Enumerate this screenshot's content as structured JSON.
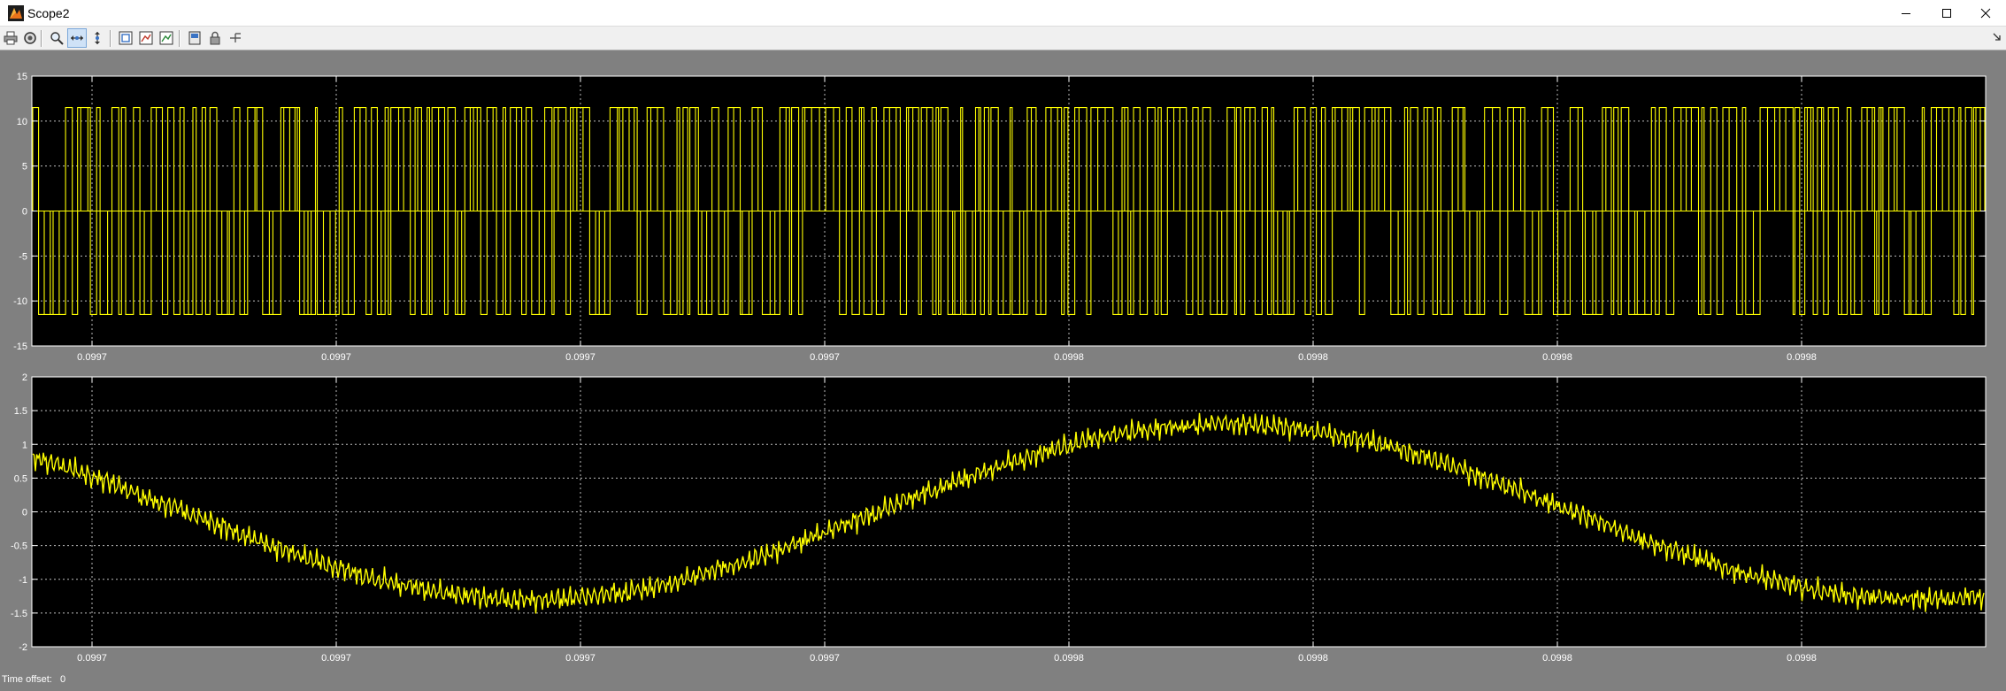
{
  "window": {
    "title": "Scope2",
    "icon": "simulink-scope-icon",
    "buttons": [
      "minimize-icon",
      "maximize-icon",
      "close-icon"
    ]
  },
  "toolbar": {
    "items": [
      "print-icon",
      "parameters-icon",
      "zoom-icon",
      "zoom-x-icon",
      "zoom-y-icon",
      "autoscale-icon",
      "save-axes-settings-icon",
      "restore-axes-settings-icon",
      "floating-scope-icon",
      "lock-axes-icon",
      "signal-selection-icon"
    ],
    "active": "zoom-x-icon"
  },
  "colors": {
    "plot_bg": "#000000",
    "signal": "#ffff00",
    "axes_frame": "#808080",
    "grid": "#bdbdbd",
    "text": "#ffffff"
  },
  "footer": {
    "time_offset_label": "Time offset:",
    "time_offset_value": "0"
  },
  "chart_data": [
    {
      "type": "line",
      "signal": "bipolar PWM pulse train switching between +11.5 and -11.5",
      "ylim": [
        -15,
        15
      ],
      "yticks": [
        "15",
        "10",
        "5",
        "0",
        "-5",
        "-10",
        "-15"
      ],
      "xticks": [
        "0.0997",
        "0.0997",
        "0.0997",
        "0.0997",
        "0.0998",
        "0.0998",
        "0.0998",
        "0.0998"
      ],
      "levels": [
        11.5,
        -11.5
      ],
      "grid": true
    },
    {
      "type": "line",
      "signal": "noisy sinusoid, approx. one cycle visible, amplitude ~1.3",
      "ylim": [
        -2,
        2
      ],
      "yticks": [
        "2",
        "1.5",
        "1",
        "0.5",
        "0",
        "-0.5",
        "-1",
        "-1.5",
        "-2"
      ],
      "xticks": [
        "0.0997",
        "0.0997",
        "0.0997",
        "0.0997",
        "0.0998",
        "0.0998",
        "0.0998",
        "0.0998"
      ],
      "amplitude": 1.3,
      "grid": true
    }
  ]
}
